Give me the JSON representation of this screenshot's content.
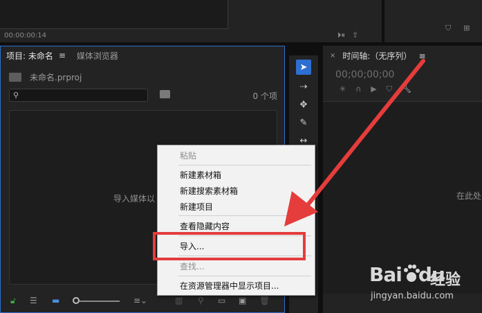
{
  "top_panel": {
    "timecode": "00:00:00:14",
    "icons": [
      "export-frame-icon",
      "share-icon"
    ]
  },
  "top_right_panel": {
    "icons": [
      "marker-icon",
      "insert-icon"
    ]
  },
  "project_panel": {
    "tab_project": "项目: 未命名",
    "tab_media_browser": "媒体浏览器",
    "menu_glyph": "≡",
    "project_file": "未命名.prproj",
    "search_placeholder": "",
    "item_count": "0 个项",
    "drop_hint": "导入媒体以"
  },
  "timeline_panel": {
    "close_glyph": "×",
    "title": "时间轴:（无序列）",
    "menu_glyph": "≡",
    "timecode": "00;00;00;00",
    "drop_hint": "在此处"
  },
  "context_menu": {
    "items": [
      {
        "label": "粘贴",
        "enabled": false
      },
      {
        "label": "新建素材箱",
        "enabled": true
      },
      {
        "label": "新建搜索素材箱",
        "enabled": true
      },
      {
        "label": "新建项目",
        "enabled": true
      },
      {
        "label": "查看隐藏内容",
        "enabled": true
      },
      {
        "label": "导入...",
        "enabled": true
      },
      {
        "label": "查找...",
        "enabled": false
      },
      {
        "label": "在资源管理器中显示项目...",
        "enabled": true
      }
    ]
  },
  "annotation": {
    "color": "#e53c3c"
  },
  "watermark": {
    "logo": "Bai",
    "logo_end": "du",
    "cn": "经验",
    "url": "jingyan.baidu.com"
  },
  "colors": {
    "accent": "#2d6fd1",
    "panel": "#232323",
    "menu_bg": "#f2f2f2"
  }
}
